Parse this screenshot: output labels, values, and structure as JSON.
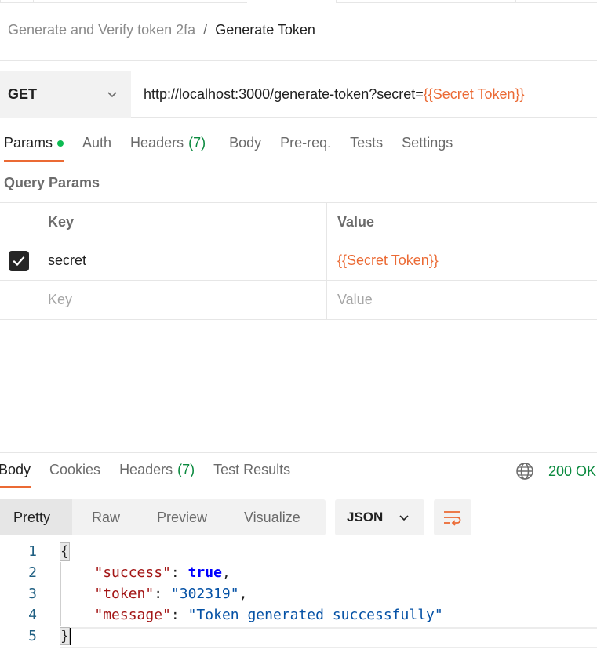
{
  "breadcrumb": {
    "parent": "Generate and Verify token 2fa",
    "separator": "/",
    "current": "Generate Token"
  },
  "request": {
    "method": "GET",
    "url_base": "http://localhost:3000/generate-token?secret=",
    "url_variable": "{{Secret Token}}"
  },
  "request_tabs": [
    {
      "label": "Params",
      "active": true,
      "has_dot": true
    },
    {
      "label": "Auth"
    },
    {
      "label": "Headers",
      "count": "(7)"
    },
    {
      "label": "Body"
    },
    {
      "label": "Pre-req."
    },
    {
      "label": "Tests"
    },
    {
      "label": "Settings"
    }
  ],
  "query_params": {
    "title": "Query Params",
    "headers": {
      "key": "Key",
      "value": "Value"
    },
    "rows": [
      {
        "checked": true,
        "key": "secret",
        "value": "{{Secret Token}}"
      }
    ],
    "placeholder": {
      "key": "Key",
      "value": "Value"
    }
  },
  "response_tabs": [
    {
      "label": "Body",
      "active": true
    },
    {
      "label": "Cookies"
    },
    {
      "label": "Headers",
      "count": "(7)"
    },
    {
      "label": "Test Results"
    }
  ],
  "status": {
    "code": "200 OK",
    "color": "#0b8a3f"
  },
  "view_modes": [
    "Pretty",
    "Raw",
    "Preview",
    "Visualize"
  ],
  "active_view": "Pretty",
  "format": "JSON",
  "code": {
    "line_numbers": [
      "1",
      "2",
      "3",
      "4",
      "5"
    ],
    "open_brace": "{",
    "close_brace": "}",
    "fields": [
      {
        "key": "\"success\"",
        "value": "true",
        "type": "bool",
        "trailing": ","
      },
      {
        "key": "\"token\"",
        "value": "\"302319\"",
        "type": "str",
        "trailing": ","
      },
      {
        "key": "\"message\"",
        "value": "\"Token generated successfully\"",
        "type": "str",
        "trailing": ""
      }
    ]
  },
  "colors": {
    "accent": "#eb6a34",
    "active_dot": "#0cbb52",
    "count_green": "#0b8a3f"
  }
}
